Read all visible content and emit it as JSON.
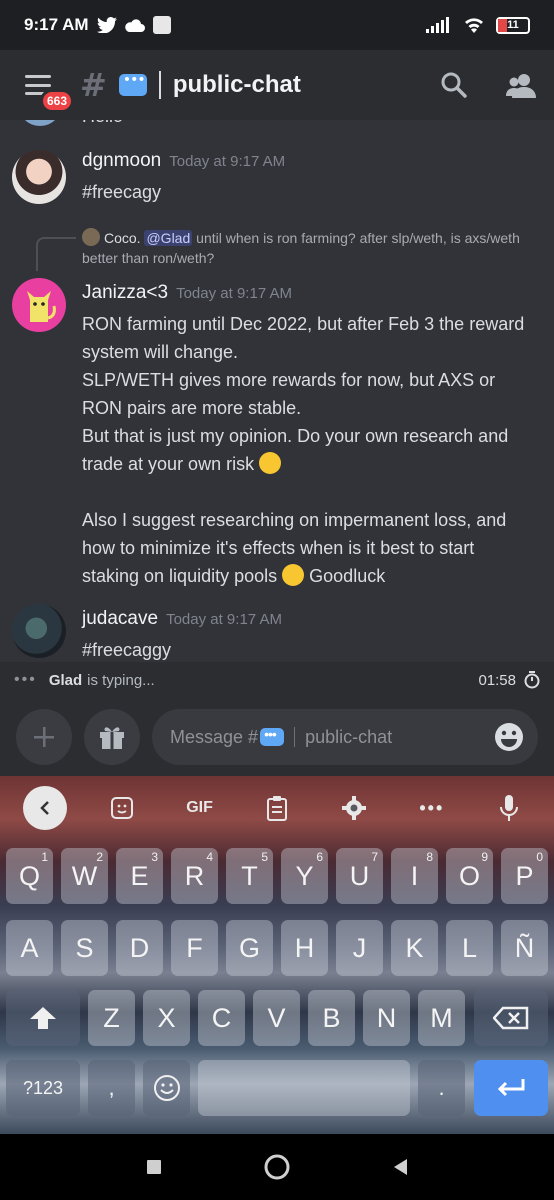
{
  "status_bar": {
    "time": "9:17 AM",
    "battery": "11"
  },
  "header": {
    "badge_count": "663",
    "hash": "#",
    "channel_name": "public-chat"
  },
  "messages": [
    {
      "text": "Hello"
    },
    {
      "author": "dgnmoon",
      "timestamp": "Today at 9:17 AM",
      "text": "#freecagy"
    },
    {
      "reply": {
        "author": "Coco.",
        "mention": "@Glad",
        "text": " until when is ron farming? after slp/weth, is axs/weth better than ron/weth?"
      },
      "author": "Janizza<3",
      "timestamp": "Today at 9:17 AM",
      "lines": [
        "RON farming until Dec 2022, but after Feb 3 the reward",
        "system will change.",
        "SLP/WETH gives more rewards for now, but AXS or",
        "RON pairs are more stable.",
        "But that is just my opinion. Do your own research and",
        "trade at your own risk",
        "",
        "Also I suggest researching on impermanent loss, and",
        "how to minimize it's effects when is it best to start",
        "staking on liquidity pools",
        "Goodluck"
      ]
    },
    {
      "author": "judacave",
      "timestamp": "Today at 9:17 AM",
      "text": "#freecaggy"
    }
  ],
  "typing": {
    "user": "Glad",
    "suffix": "is typing...",
    "timer": "01:58"
  },
  "composer": {
    "placeholder_prefix": "Message #",
    "placeholder_channel": "public-chat"
  },
  "keyboard": {
    "toolbar": {
      "gif": "GIF"
    },
    "row1": [
      [
        "Q",
        "1"
      ],
      [
        "W",
        "2"
      ],
      [
        "E",
        "3"
      ],
      [
        "R",
        "4"
      ],
      [
        "T",
        "5"
      ],
      [
        "Y",
        "6"
      ],
      [
        "U",
        "7"
      ],
      [
        "I",
        "8"
      ],
      [
        "O",
        "9"
      ],
      [
        "P",
        "0"
      ]
    ],
    "row2": [
      "A",
      "S",
      "D",
      "F",
      "G",
      "H",
      "J",
      "K",
      "L",
      "Ñ"
    ],
    "row3": [
      "Z",
      "X",
      "C",
      "V",
      "B",
      "N",
      "M"
    ],
    "symbols_label": "?123",
    "comma": ",",
    "period": "."
  },
  "colors": {
    "accent": "#5865f2",
    "mention_bg": "#3c4270",
    "badge": "#ed4245",
    "enter_key": "#4f8ff0"
  },
  "icons": [
    "menu-icon",
    "search-icon",
    "members-icon",
    "plus-icon",
    "gift-icon",
    "emoji-icon",
    "back-icon",
    "sticker-icon",
    "clipboard-icon",
    "settings-icon",
    "more-icon",
    "mic-icon",
    "shift-icon",
    "backspace-icon",
    "enter-icon"
  ]
}
